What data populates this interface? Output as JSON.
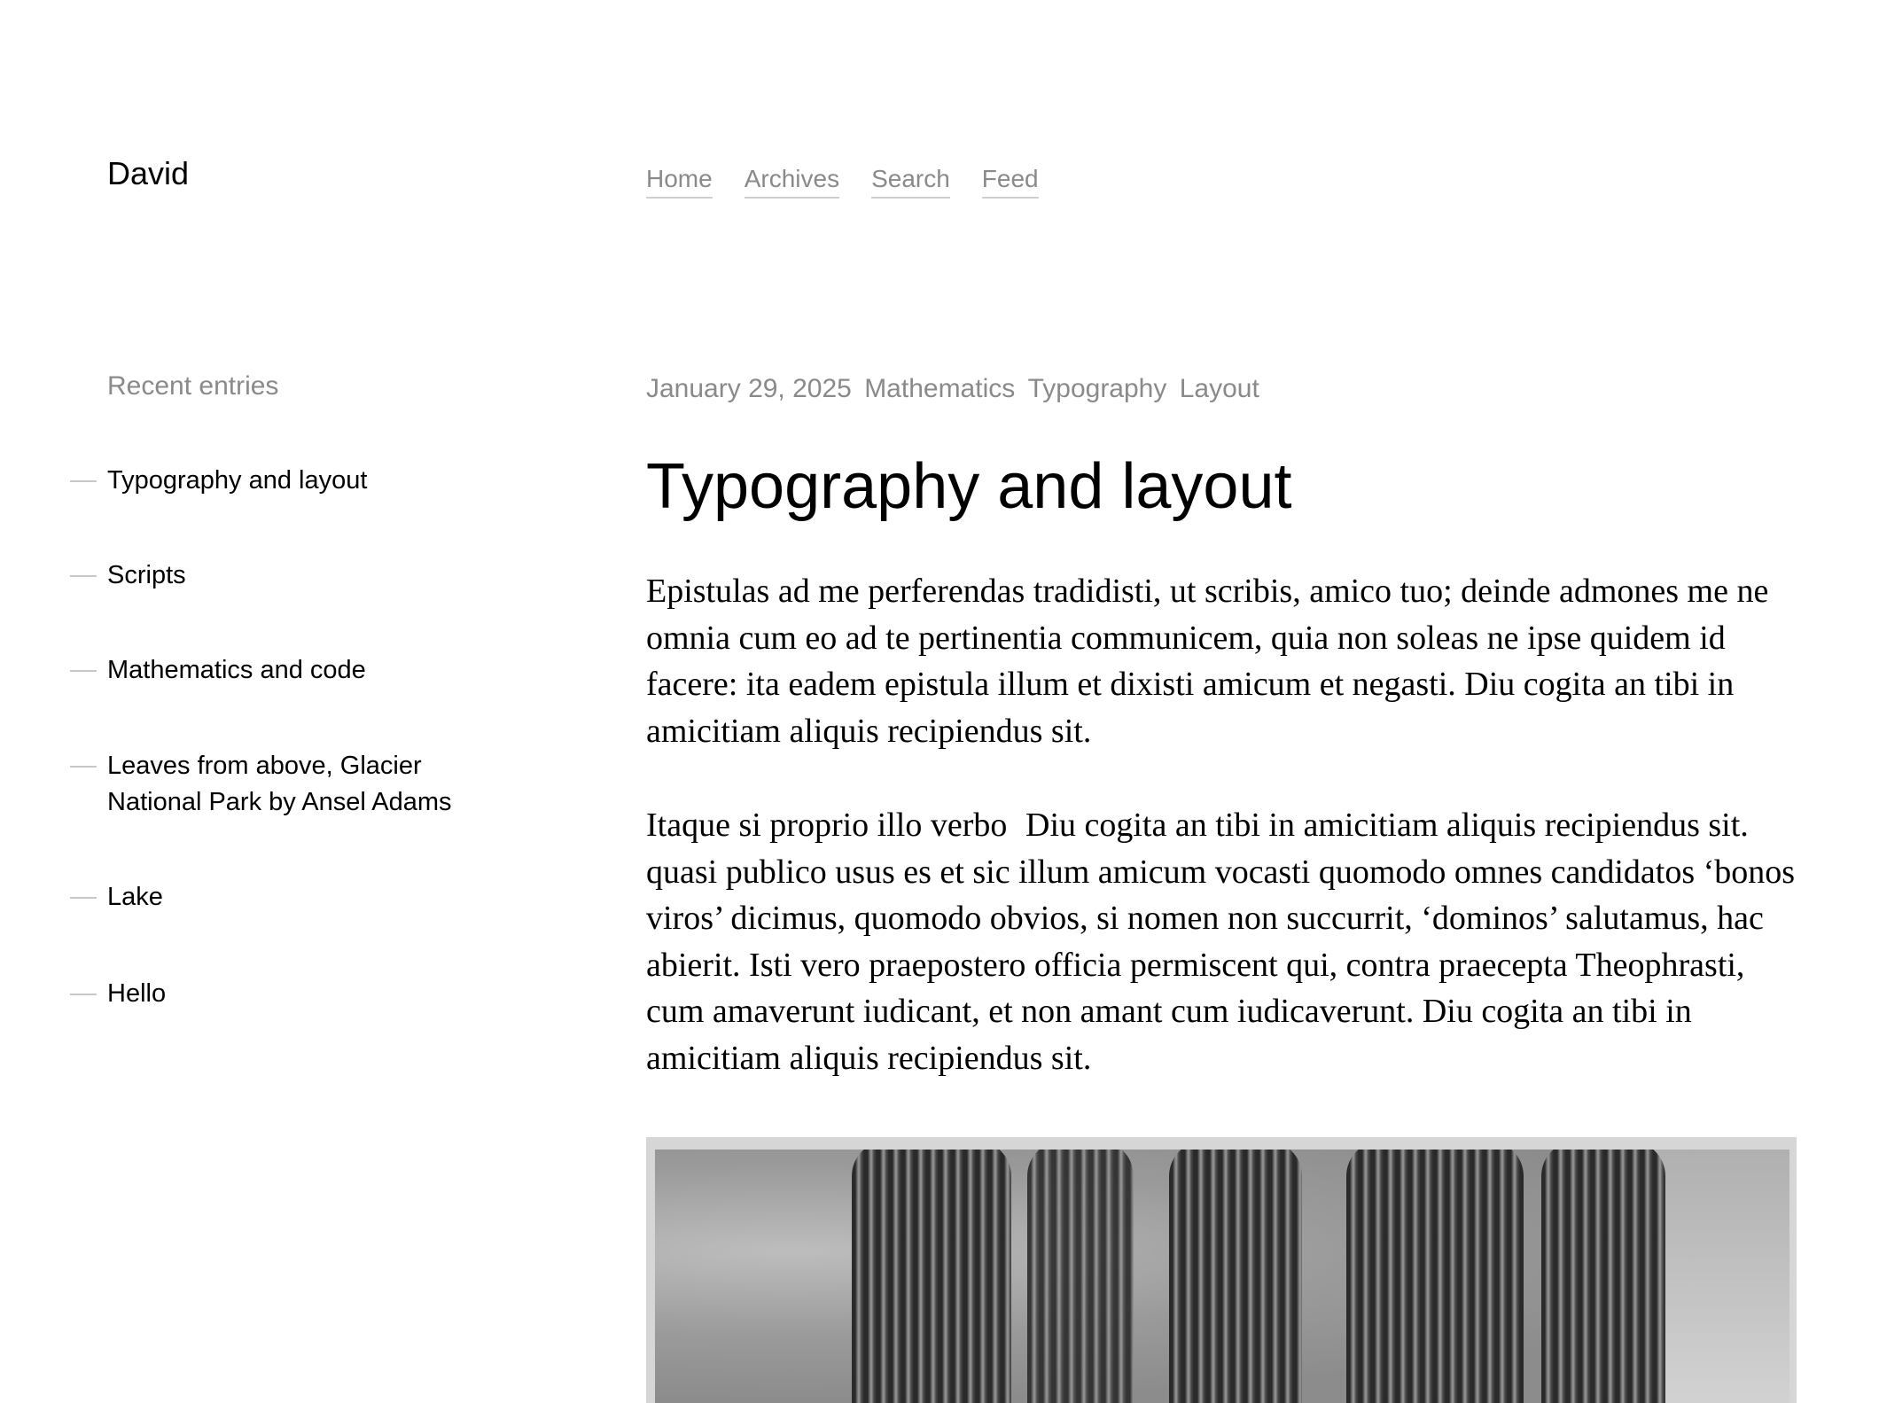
{
  "site": {
    "title": "David"
  },
  "nav": {
    "items": [
      {
        "label": "Home"
      },
      {
        "label": "Archives"
      },
      {
        "label": "Search"
      },
      {
        "label": "Feed"
      }
    ]
  },
  "sidebar": {
    "heading": "Recent entries",
    "entries": [
      {
        "label": "Typography and layout"
      },
      {
        "label": "Scripts"
      },
      {
        "label": "Mathematics and code"
      },
      {
        "label": "Leaves from above, Glacier National Park by Ansel Adams"
      },
      {
        "label": "Lake"
      },
      {
        "label": "Hello"
      }
    ]
  },
  "post": {
    "date": "January 29, 2025",
    "tags": [
      "Mathematics",
      "Typography",
      "Layout"
    ],
    "title": "Typography and layout",
    "paragraph1": "Epistulas ad me perferendas tradidisti, ut scribis, amico tuo; deinde admones me ne omnia cum eo ad te pertinentia communicem, quia non soleas ne ipse quidem id facere: ita eadem epistula illum et dixisti amicum et negasti. Diu cogita an tibi in amicitiam aliquis recipiendus sit.",
    "paragraph2_lead": "Itaque si proprio illo",
    "paragraph2_pullquote": "Diu cogita an tibi in amicitiam aliquis recipiendus sit.",
    "paragraph2_rest": "verbo quasi publico usus es et sic illum amicum vocasti quomodo omnes candidatos ‘bonos viros’ dicimus, quomodo obvios, si nomen non succurrit, ‘dominos’ salutamus, hac abierit. Isti vero praepostero officia permiscent qui, contra praecepta Theophrasti, cum amaverunt iudicant, et non amant cum iudicaverunt. Diu cogita an tibi in amicitiam aliquis recipiendus sit."
  },
  "colors": {
    "text": "#000000",
    "muted": "#8a8a8a",
    "underline": "#cfcfcf",
    "dash": "#c8c8c8",
    "background": "#ffffff"
  }
}
